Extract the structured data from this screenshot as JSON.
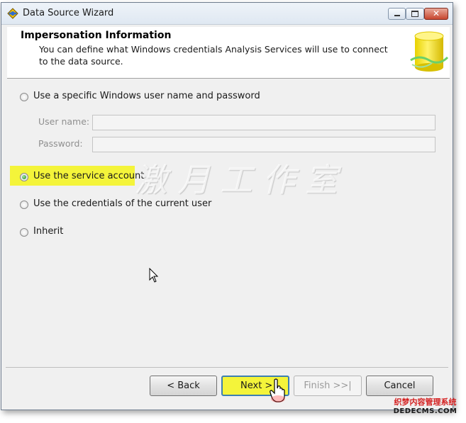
{
  "window": {
    "title": "Data Source Wizard",
    "controls": {
      "minimize": "minimize",
      "maximize": "maximize",
      "close": "✕"
    }
  },
  "header": {
    "title": "Impersonation Information",
    "description": "You can define what Windows credentials Analysis Services will use to connect to the data source."
  },
  "options": [
    {
      "label": "Use a specific Windows user name and password",
      "checked": false
    },
    {
      "label": "Use the service account",
      "checked": true
    },
    {
      "label": "Use the credentials of the current user",
      "checked": false
    },
    {
      "label": "Inherit",
      "checked": false
    }
  ],
  "fields": {
    "username_label": "User name:",
    "username_value": "",
    "password_label": "Password:",
    "password_value": ""
  },
  "buttons": {
    "back": "< Back",
    "next": "Next >",
    "finish": "Finish >>|",
    "cancel": "Cancel"
  },
  "watermark_text": "激月工作室",
  "site_mark": {
    "name": "织梦内容管理系统",
    "url": "DEDECMS.COM"
  },
  "colors": {
    "highlight": "#f4f43a",
    "radio_selected": "#1e8a1e",
    "next_button_border": "#3c7fb1"
  }
}
